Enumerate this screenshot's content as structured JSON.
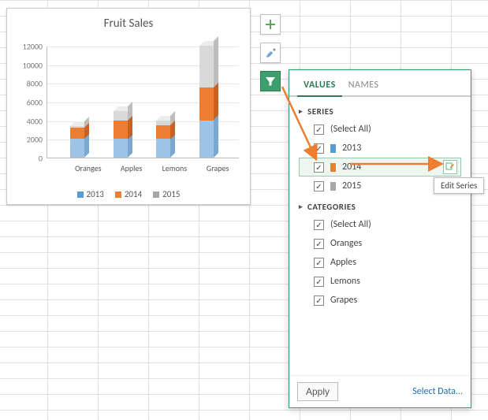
{
  "chart_data": {
    "type": "bar",
    "title": "Fruit Sales",
    "categories": [
      "Oranges",
      "Apples",
      "Lemons",
      "Grapes"
    ],
    "series": [
      {
        "name": "2013",
        "values": [
          2000,
          2000,
          2000,
          4000
        ],
        "color": "#5b9bd5"
      },
      {
        "name": "2014",
        "values": [
          1200,
          2000,
          1500,
          3500
        ],
        "color": "#ed7d31"
      },
      {
        "name": "2015",
        "values": [
          200,
          1000,
          500,
          4500
        ],
        "color": "#a6a6a6"
      }
    ],
    "ylim": [
      0,
      12000
    ],
    "ystep": 2000,
    "legend_position": "bottom",
    "stacked": true,
    "style": "3d"
  },
  "yticks": [
    {
      "v": 12000,
      "label": "12000"
    },
    {
      "v": 10000,
      "label": "10000"
    },
    {
      "v": 8000,
      "label": "8000"
    },
    {
      "v": 6000,
      "label": "6000"
    },
    {
      "v": 4000,
      "label": "4000"
    },
    {
      "v": 2000,
      "label": "2000"
    },
    {
      "v": 0,
      "label": "0"
    }
  ],
  "side_buttons": {
    "plus_active": false,
    "brush_active": false,
    "filter_active": true
  },
  "filter_panel": {
    "tabs": {
      "values": "VALUES",
      "names": "NAMES",
      "active": "values"
    },
    "sections": {
      "series": {
        "header": "SERIES",
        "items": [
          {
            "label": "(Select All)",
            "checked": true,
            "swatch": null
          },
          {
            "label": "2013",
            "checked": true,
            "swatch": "blue"
          },
          {
            "label": "2014",
            "checked": true,
            "swatch": "orange",
            "hovered": true
          },
          {
            "label": "2015",
            "checked": true,
            "swatch": "grey"
          }
        ]
      },
      "categories": {
        "header": "CATEGORIES",
        "items": [
          {
            "label": "(Select All)",
            "checked": true
          },
          {
            "label": "Oranges",
            "checked": true
          },
          {
            "label": "Apples",
            "checked": true
          },
          {
            "label": "Lemons",
            "checked": true
          },
          {
            "label": "Grapes",
            "checked": true
          }
        ]
      }
    },
    "footer": {
      "apply": "Apply",
      "select_data": "Select Data..."
    }
  },
  "tooltip": "Edit Series"
}
